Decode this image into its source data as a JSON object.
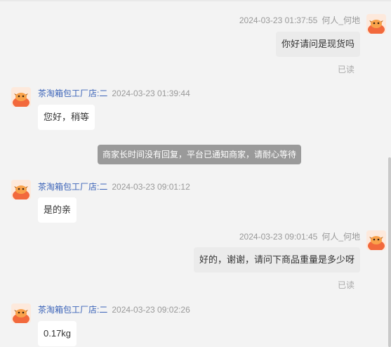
{
  "messages": [
    {
      "side": "right",
      "name": "何人_何地",
      "time": "2024-03-23 01:37:55",
      "text": "你好请问是现货吗",
      "status": "已读"
    },
    {
      "side": "left",
      "name": "茶淘箱包工厂店:二",
      "time": "2024-03-23 01:39:44",
      "text": "您好，稍等"
    },
    {
      "side": "notice",
      "text": "商家长时间没有回复，平台已通知商家，请耐心等待"
    },
    {
      "side": "left",
      "name": "茶淘箱包工厂店:二",
      "time": "2024-03-23 09:01:12",
      "text": "是的亲"
    },
    {
      "side": "right",
      "name": "何人_何地",
      "time": "2024-03-23 09:01:45",
      "text": "好的，谢谢，请问下商品重量是多少呀",
      "status": "已读"
    },
    {
      "side": "left",
      "name": "茶淘箱包工厂店:二",
      "time": "2024-03-23 09:02:26",
      "text": "0.17kg"
    }
  ],
  "avatar_icon": "cartoon-cow-avatar",
  "colors": {
    "shop_name": "#3b63b8",
    "notice_bg": "#9a9a9a",
    "my_bubble": "#ebebeb"
  }
}
